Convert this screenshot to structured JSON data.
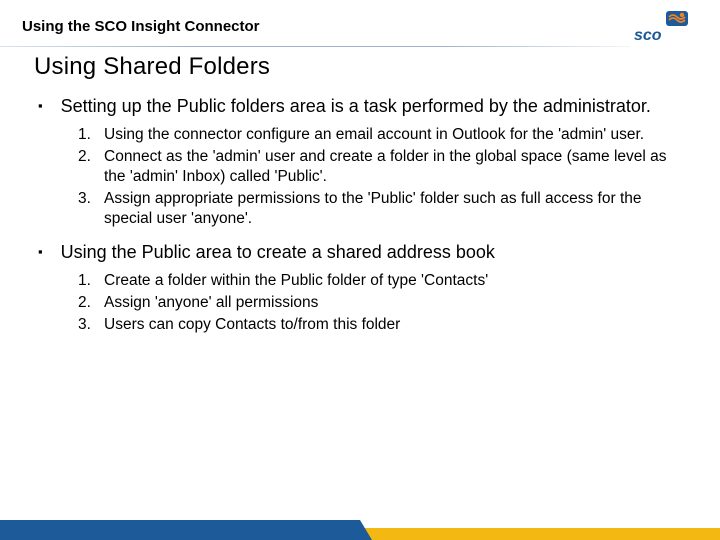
{
  "header": {
    "title": "Using the SCO Insight Connector",
    "logo_text": "sco"
  },
  "section_title": "Using Shared Folders",
  "bullets": [
    {
      "text": "Setting up the Public folders area is a task performed by the administrator.",
      "sub": [
        "Using the connector configure an email account in Outlook for the 'admin' user.",
        "Connect as the 'admin' user and create a folder in the global space (same level as the 'admin' Inbox) called 'Public'.",
        "Assign appropriate permissions to the 'Public' folder such as full access for the special user 'anyone'."
      ]
    },
    {
      "text": "Using the Public area to create a shared address book",
      "sub": [
        "Create a folder within the Public folder of type 'Contacts'",
        "Assign 'anyone' all permissions",
        "Users can copy Contacts to/from this folder"
      ]
    }
  ],
  "colors": {
    "brand_blue": "#1c5a9a",
    "brand_yellow": "#f4b812",
    "logo_orange": "#f58220"
  }
}
